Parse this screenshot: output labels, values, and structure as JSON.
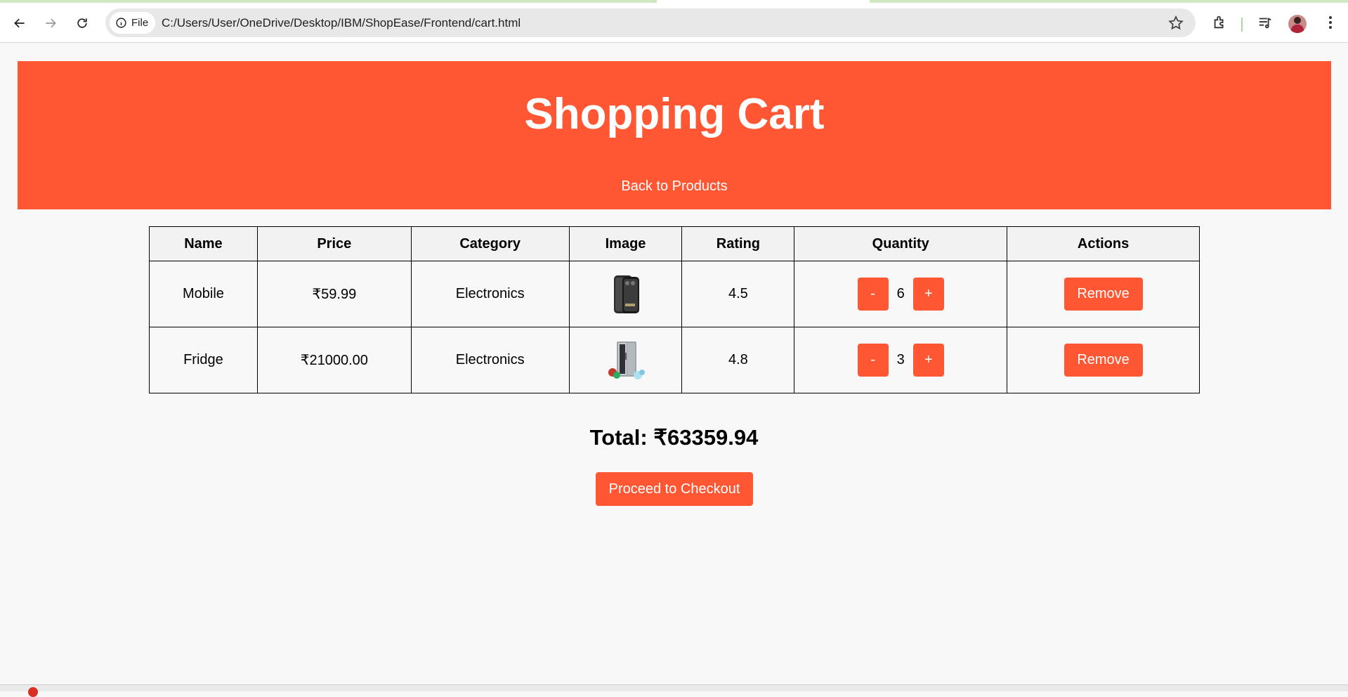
{
  "browser": {
    "file_label": "File",
    "url": "C:/Users/User/OneDrive/Desktop/IBM/ShopEase/Frontend/cart.html"
  },
  "header": {
    "title": "Shopping Cart",
    "back_link": "Back to Products"
  },
  "table": {
    "columns": [
      "Name",
      "Price",
      "Category",
      "Image",
      "Rating",
      "Quantity",
      "Actions"
    ],
    "rows": [
      {
        "name": "Mobile",
        "price": "₹59.99",
        "category": "Electronics",
        "image": "mobile-phone-image",
        "rating": "4.5",
        "quantity": "6",
        "minus": "-",
        "plus": "+",
        "remove": "Remove"
      },
      {
        "name": "Fridge",
        "price": "₹21000.00",
        "category": "Electronics",
        "image": "fridge-image",
        "rating": "4.8",
        "quantity": "3",
        "minus": "-",
        "plus": "+",
        "remove": "Remove"
      }
    ]
  },
  "total": "Total: ₹63359.94",
  "checkout_label": "Proceed to Checkout",
  "colors": {
    "accent": "#ff5733",
    "page_bg": "#f8f8f8"
  },
  "icons": [
    "back-arrow-icon",
    "forward-arrow-icon",
    "reload-icon",
    "info-icon",
    "star-icon",
    "extensions-icon",
    "media-icon",
    "avatar",
    "kebab-menu-icon"
  ]
}
